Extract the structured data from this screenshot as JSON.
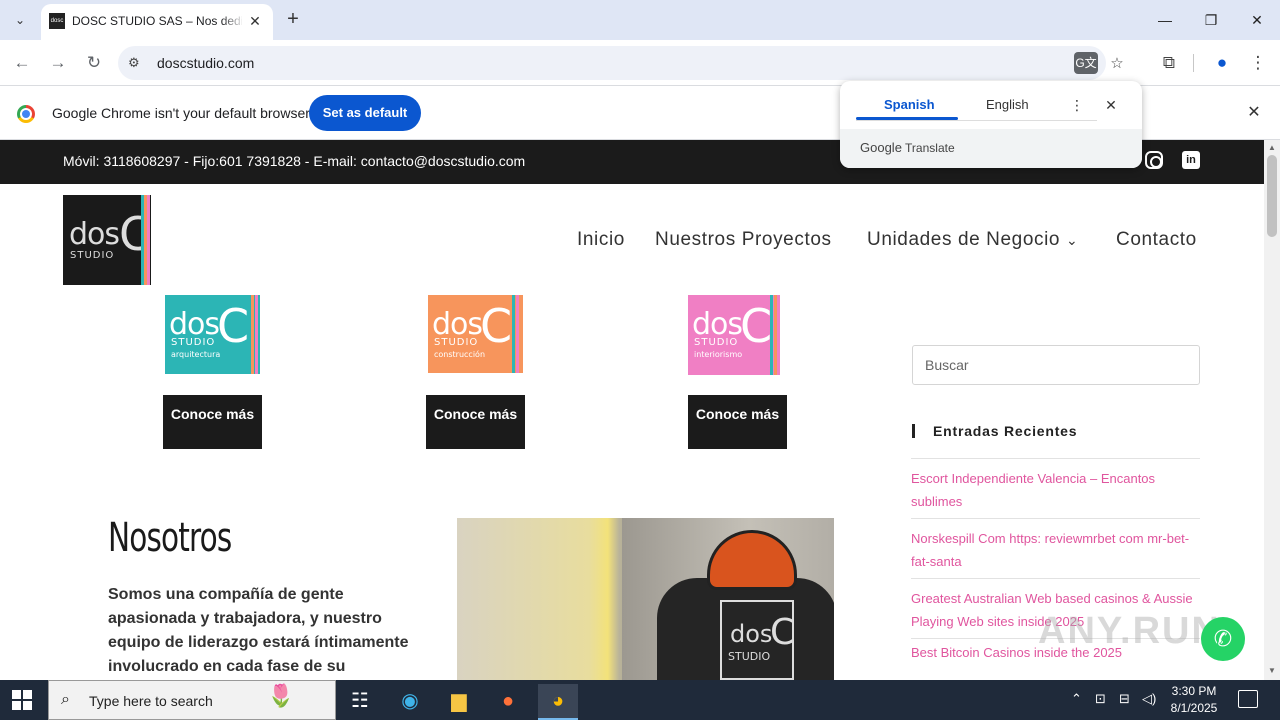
{
  "browser": {
    "tab_title": "DOSC STUDIO SAS – Nos dedic",
    "url": "doscstudio.com",
    "infobar_text": "Google Chrome isn't your default browser",
    "set_default_label": "Set as default"
  },
  "translate_popup": {
    "lang_source": "Spanish",
    "lang_target": "English",
    "brand_google": "Google",
    "brand_translate": "Translate"
  },
  "site": {
    "contact_line": "Móvil: 3118608297 - Fijo:601 7391828 - E-mail: contacto@doscstudio.com",
    "logo": {
      "dos": "dos",
      "c": "C",
      "studio": "STUDIO"
    },
    "nav": [
      "Inicio",
      "Nuestros Proyectos",
      "Unidades de Negocio",
      "Contacto"
    ],
    "units": [
      {
        "sub": "arquitectura",
        "button": "Conoce más",
        "color": "#2cb5b5"
      },
      {
        "sub": "construcción",
        "button": "Conoce más",
        "color": "#f7955c"
      },
      {
        "sub": "interiorismo",
        "button": "Conoce más",
        "color": "#f07fc4"
      }
    ],
    "nosotros_title": "Nosotros",
    "nosotros_text": "Somos una compañía de gente apasionada y trabajadora, y nuestro equipo de liderazgo estará íntimamente involucrado en cada fase de su proyecto.",
    "search_placeholder": "Buscar",
    "recent_title": "Entradas Recientes",
    "recent_posts": [
      "Escort Independiente Valencia – Encantos sublimes",
      "Norskespill Com https: reviewmrbet com mr-bet-fat-santa",
      "Greatest Australian Web based casinos & Aussie Playing Web sites inside 2025",
      "Best Bitcoin Casinos inside the 2025"
    ],
    "link_color": "#e0559e",
    "watermark": "ANY.RUN"
  },
  "taskbar": {
    "search_text": "Type here to search",
    "time": "3:30 PM",
    "date": "8/1/2025"
  }
}
